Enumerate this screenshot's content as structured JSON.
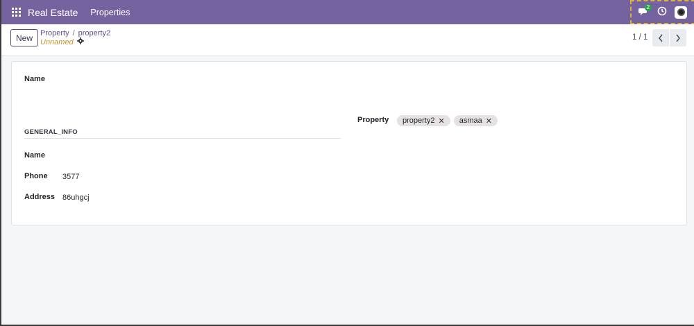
{
  "navbar": {
    "app_name": "Real Estate",
    "menu": [
      "Properties"
    ],
    "chat_badge": "2"
  },
  "control_panel": {
    "new_label": "New",
    "breadcrumb": [
      "Property",
      "property2"
    ],
    "breadcrumb_separator": "/",
    "record_status": "Unnamed",
    "pager": "1 / 1"
  },
  "form": {
    "name_label": "Name",
    "group_title": "GENERAL_INFO",
    "fields": [
      {
        "label": "Name",
        "value": ""
      },
      {
        "label": "Phone",
        "value": "3577"
      },
      {
        "label": "Address",
        "value": "86uhgcj"
      }
    ],
    "property_label": "Property",
    "property_tags": [
      "property2",
      "asmaa"
    ]
  },
  "colors": {
    "navbar": "#7563a0",
    "unnamed": "#c9922e",
    "badge": "#28a745",
    "link": "#5d4f86"
  }
}
